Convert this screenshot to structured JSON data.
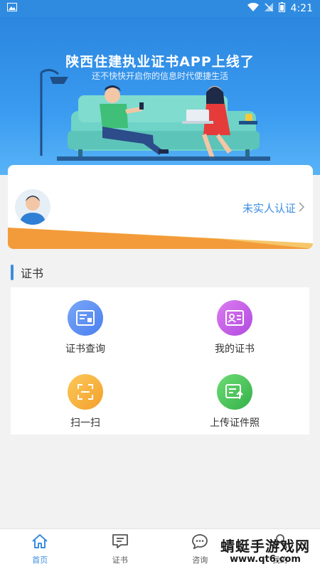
{
  "status_bar": {
    "time": "4:21"
  },
  "banner": {
    "title": "陕西住建执业证书APP上线了",
    "subtitle": "还不快快开启你的信息时代便捷生活"
  },
  "user_card": {
    "verify_label": "未实人认证"
  },
  "section": {
    "title": "证书"
  },
  "grid_items": [
    {
      "label": "证书查询",
      "icon": "certificate-search-icon",
      "color": "#5b8ff4"
    },
    {
      "label": "我的证书",
      "icon": "id-card-icon",
      "color": "#c657e8"
    },
    {
      "label": "扫一扫",
      "icon": "scan-icon",
      "color": "#f7b23e"
    },
    {
      "label": "上传证件照",
      "icon": "upload-photo-icon",
      "color": "#4cc45b"
    }
  ],
  "tabs": [
    {
      "label": "首页",
      "icon": "home-icon",
      "active": true
    },
    {
      "label": "证书",
      "icon": "certificate-icon",
      "active": false
    },
    {
      "label": "咨询",
      "icon": "chat-icon",
      "active": false
    },
    {
      "label": "我的",
      "icon": "user-icon",
      "active": false
    }
  ],
  "watermark": {
    "main": "蜻蜓手游戏网",
    "sub": "www.qt6.com"
  },
  "colors": {
    "primary": "#3a8de0",
    "banner": "#2b86df",
    "accent_orange": "#f5a53c"
  }
}
